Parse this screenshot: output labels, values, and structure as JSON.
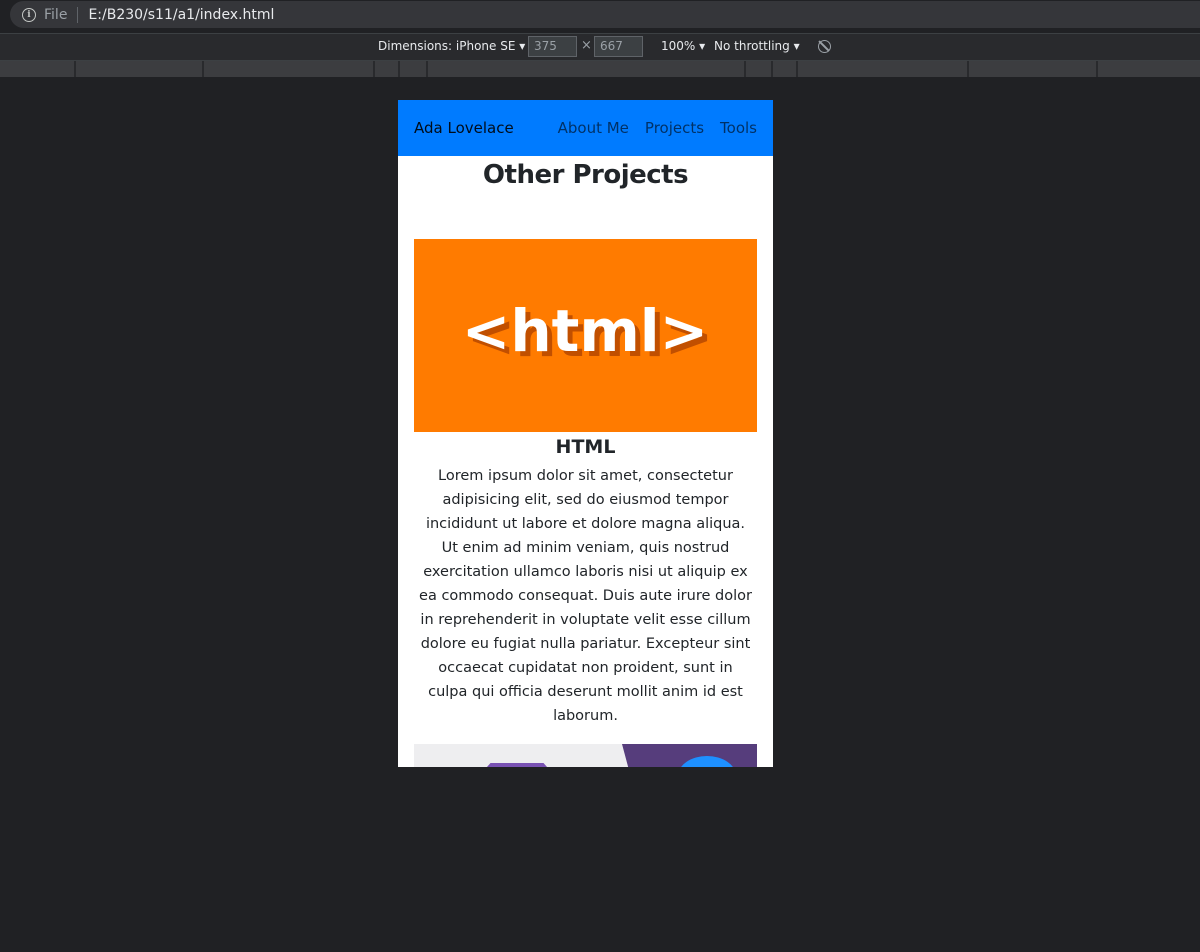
{
  "browser": {
    "scheme": "File",
    "url": "E:/B230/s11/a1/index.html"
  },
  "device_toolbar": {
    "dimensions_label": "Dimensions: iPhone SE",
    "width": "375",
    "height": "667",
    "zoom": "100%",
    "throttling": "No throttling"
  },
  "page": {
    "brand": "Ada Lovelace",
    "nav": [
      "About Me",
      "Projects",
      "Tools"
    ],
    "section_title": "Other Projects",
    "card": {
      "image_text": "<html>",
      "title": "HTML",
      "text": "Lorem ipsum dolor sit amet, consectetur adipisicing elit, sed do eiusmod tempor incididunt ut labore et dolore magna aliqua. Ut enim ad minim veniam, quis nostrud exercitation ullamco laboris nisi ut aliquip ex ea commodo consequat. Duis aute irure dolor in reprehenderit in voluptate velit esse cillum dolore eu fugiat nulla pariatur. Excepteur sint occaecat cupidatat non proident, sunt in culpa qui officia deserunt mollit anim id est laborum."
    }
  },
  "colors": {
    "navbar": "#007bff",
    "html_card": "#ff7b00",
    "bootstrap_purple": "#7952b3"
  }
}
